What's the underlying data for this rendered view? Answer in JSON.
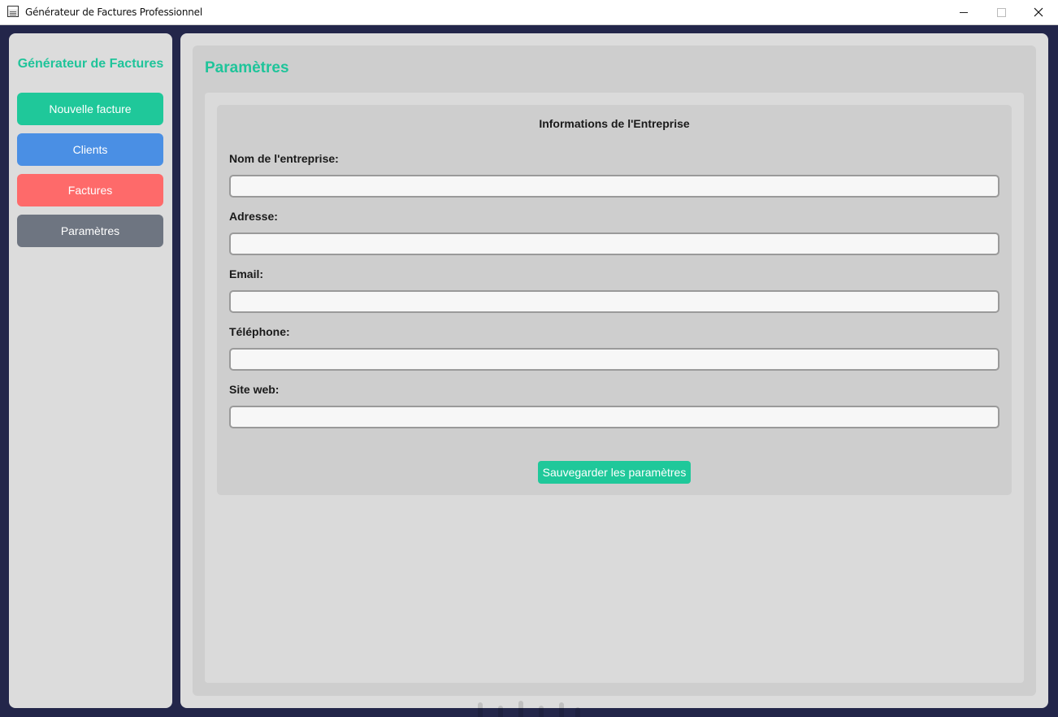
{
  "window": {
    "title": "Générateur de Factures Professionnel"
  },
  "sidebar": {
    "brand": "Générateur de Factures",
    "items": [
      {
        "label": "Nouvelle facture",
        "color": "#1fc89a"
      },
      {
        "label": "Clients",
        "color": "#4a8fe4"
      },
      {
        "label": "Factures",
        "color": "#fe6a6a"
      },
      {
        "label": "Paramètres",
        "color": "#6e7581"
      }
    ]
  },
  "main": {
    "title": "Paramètres",
    "card": {
      "title": "Informations de l'Entreprise",
      "fields": [
        {
          "label": "Nom de l'entreprise:",
          "value": ""
        },
        {
          "label": "Adresse:",
          "value": ""
        },
        {
          "label": "Email:",
          "value": ""
        },
        {
          "label": "Téléphone:",
          "value": ""
        },
        {
          "label": "Site web:",
          "value": ""
        }
      ],
      "save_label": "Sauvegarder les paramètres"
    }
  },
  "colors": {
    "accent": "#1fc49a",
    "background": "#23264a",
    "panel": "#dcdcdc"
  }
}
